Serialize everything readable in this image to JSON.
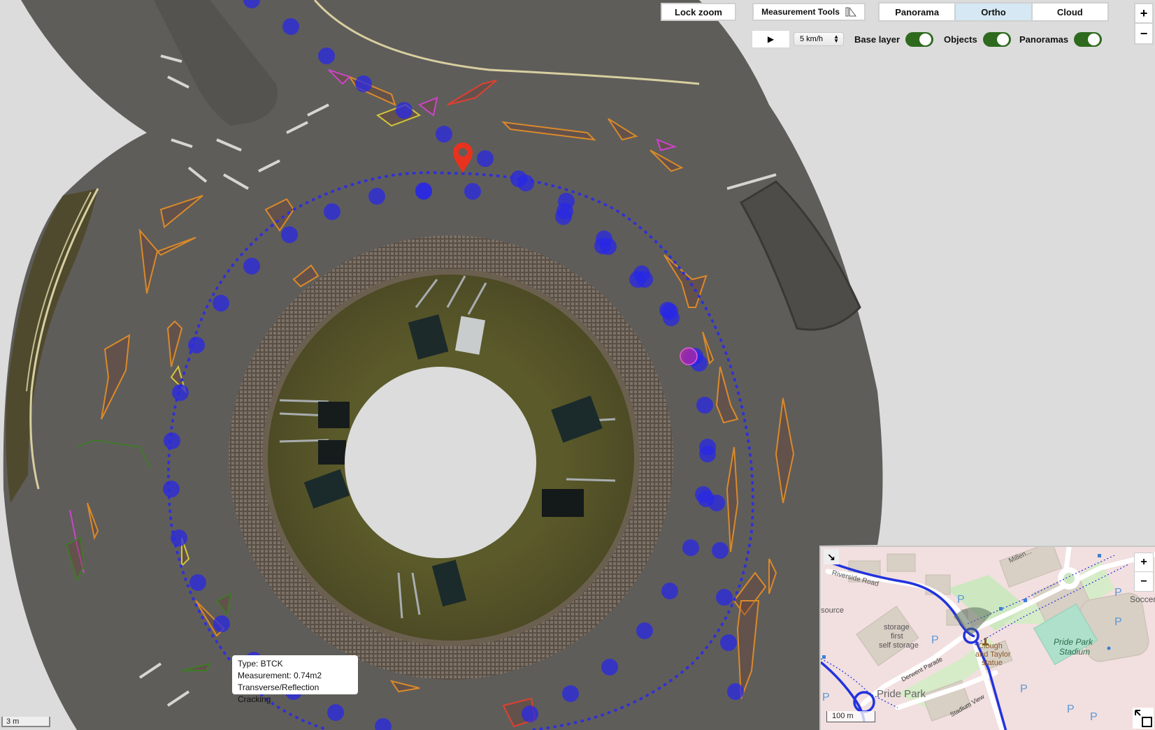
{
  "toolbar": {
    "lock_zoom_label": "Lock zoom",
    "measurement_tools_label": "Measurement Tools",
    "measurement_icon": "ruler-triangle-icon",
    "view_modes": [
      {
        "label": "Panorama",
        "active": false
      },
      {
        "label": "Ortho",
        "active": true
      },
      {
        "label": "Cloud",
        "active": false
      }
    ],
    "zoom_in_label": "+",
    "zoom_out_label": "−"
  },
  "playback": {
    "play_icon": "▶",
    "speed_value": "5 km/h"
  },
  "layers": [
    {
      "label": "Base layer",
      "on": true
    },
    {
      "label": "Objects",
      "on": true
    },
    {
      "label": "Panoramas",
      "on": true
    }
  ],
  "tooltip": {
    "type_line": "Type: BTCK",
    "measurement_line": "Measurement: 0.74m2",
    "description": "Transverse/Reflection Cracking"
  },
  "scale_bar": "3 m",
  "minimap": {
    "collapse_icon": "↘",
    "zoom_in_label": "+",
    "zoom_out_label": "−",
    "scale_bar": "100 m",
    "labels": {
      "riverside": "Riverside Road",
      "millennium": "Millen...",
      "source": "source",
      "storage": "storage\nfirst\nself storage",
      "storage_1": "storage",
      "storage_2": "first",
      "storage_3": "self storage",
      "derwent": "Derwent Parade",
      "clough_1": "Clough",
      "clough_2": "and Taylor",
      "clough_3": "statue",
      "stadium_1": "Pride Park",
      "stadium_2": "Stadium",
      "pride_park": "Pride Park",
      "stadium_view": "Stadium View",
      "soccer": "Soccer",
      "parking": "P"
    },
    "colors": {
      "track": "#2233dd",
      "stadium": "#aee0cc"
    }
  },
  "colors": {
    "panorama_dot": "#2a2ad8",
    "marker": "#e8321e",
    "toggle_on": "#2e6a1e",
    "active_tab": "#d5e8f3"
  }
}
